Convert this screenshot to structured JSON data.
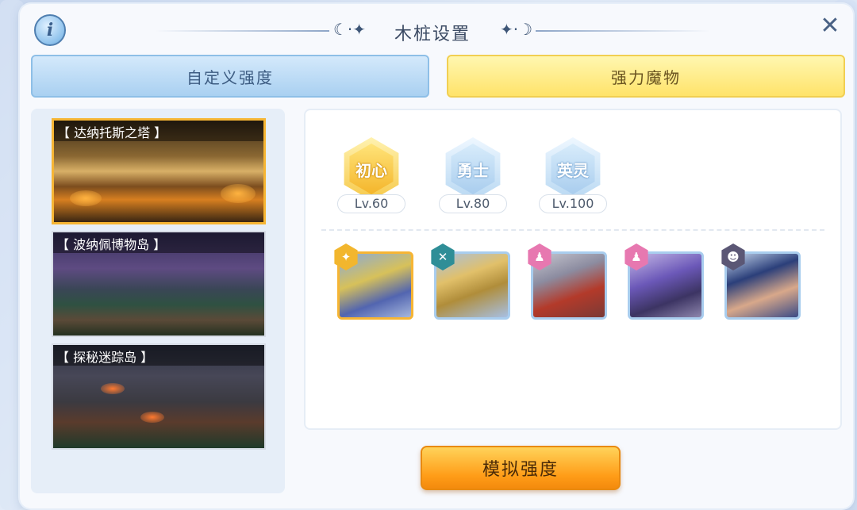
{
  "header": {
    "title": "木桩设置",
    "info_icon": "i",
    "close_icon": "close-icon"
  },
  "tabs": [
    {
      "label": "自定义强度",
      "active": false
    },
    {
      "label": "强力魔物",
      "active": true
    }
  ],
  "maps": [
    {
      "name": "【 达纳托斯之塔 】",
      "selected": true
    },
    {
      "name": "【 波纳佩博物岛 】",
      "selected": false
    },
    {
      "name": "【 探秘迷踪岛 】",
      "selected": false
    }
  ],
  "levels": [
    {
      "name": "初心",
      "level": "Lv.60",
      "selected": true
    },
    {
      "name": "勇士",
      "level": "Lv.80",
      "selected": false
    },
    {
      "name": "英灵",
      "level": "Lv.100",
      "selected": false
    }
  ],
  "monsters": [
    {
      "icon": "golden-knight-portrait",
      "badge_color": "#f2b62e",
      "badge_glyph": "✦",
      "selected": true
    },
    {
      "icon": "golden-relic-portrait",
      "badge_color": "#2f8e97",
      "badge_glyph": "✕",
      "selected": false
    },
    {
      "icon": "silver-beast-portrait",
      "badge_color": "#e778b0",
      "badge_glyph": "♟",
      "selected": false
    },
    {
      "icon": "purple-spike-portrait",
      "badge_color": "#e778b0",
      "badge_glyph": "♟",
      "selected": false
    },
    {
      "icon": "dark-hero-portrait",
      "badge_color": "#5b5775",
      "badge_glyph": "☻",
      "selected": false
    }
  ],
  "actions": {
    "simulate_label": "模拟强度"
  },
  "colors": {
    "accent_gold": "#f6b534",
    "accent_blue": "#a9cdee",
    "button_orange": "#ff9c17"
  }
}
